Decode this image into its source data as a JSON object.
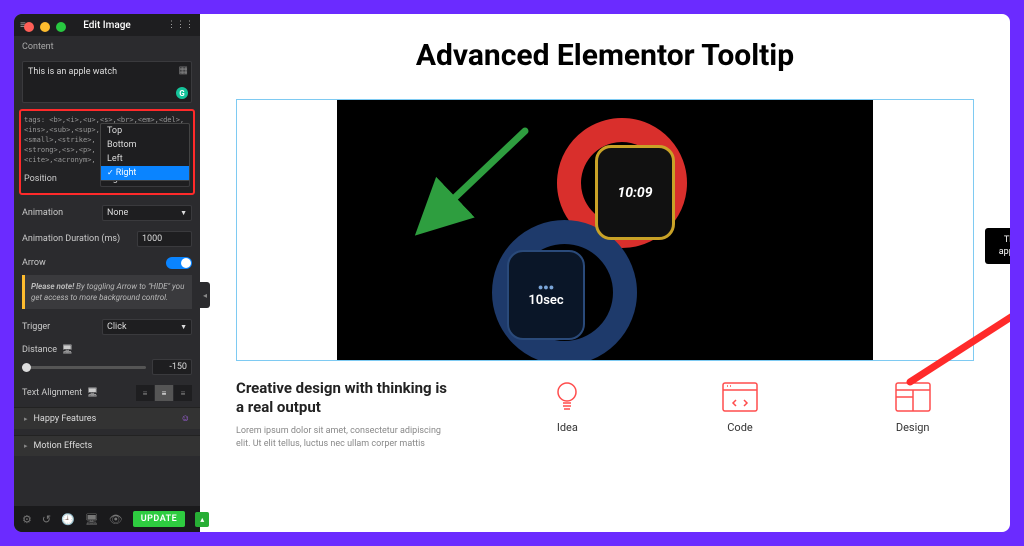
{
  "sidebar": {
    "title": "Edit Image",
    "content_label": "Content",
    "content_value": "This is an apple watch",
    "allowed_tags": "tags: <b>,<i>,<u>,<s>,<br>,<em>,<del>,\n<ins>,<sub>,<sup>,<code>,<mark>,\n<small>,<strike>,\n<strong>,<s>,<p>,\n<cite>,<acronym>,",
    "position_label": "Position",
    "position_options": [
      "Top",
      "Bottom",
      "Left",
      "Right"
    ],
    "position_selected": "Right",
    "animation_label": "Animation",
    "animation_value": "None",
    "duration_label": "Animation Duration (ms)",
    "duration_value": "1000",
    "arrow_label": "Arrow",
    "note_html": "Please note! By toggling Arrow to \"HIDE\" you get access to more background control.",
    "note_prefix": "Please note!",
    "note_rest": " By toggling Arrow to \"HIDE\" you get access to more background control.",
    "trigger_label": "Trigger",
    "trigger_value": "Click",
    "distance_label": "Distance",
    "distance_value": "-150",
    "textalign_label": "Text Alignment",
    "accordion1": "Happy Features",
    "accordion2": "Motion Effects",
    "update_btn": "UPDATE"
  },
  "canvas": {
    "title": "Advanced Elementor Tooltip",
    "tooltip_text": "This is an apple watch",
    "watch_time": "10:09",
    "watch_sec": "10sec",
    "content_heading": "Creative design with thinking is a real output",
    "content_para": "Lorem ipsum dolor sit amet, consectetur adipiscing elit. Ut elit tellus, luctus nec ullam corper mattis",
    "feat1": "Idea",
    "feat2": "Code",
    "feat3": "Design"
  }
}
